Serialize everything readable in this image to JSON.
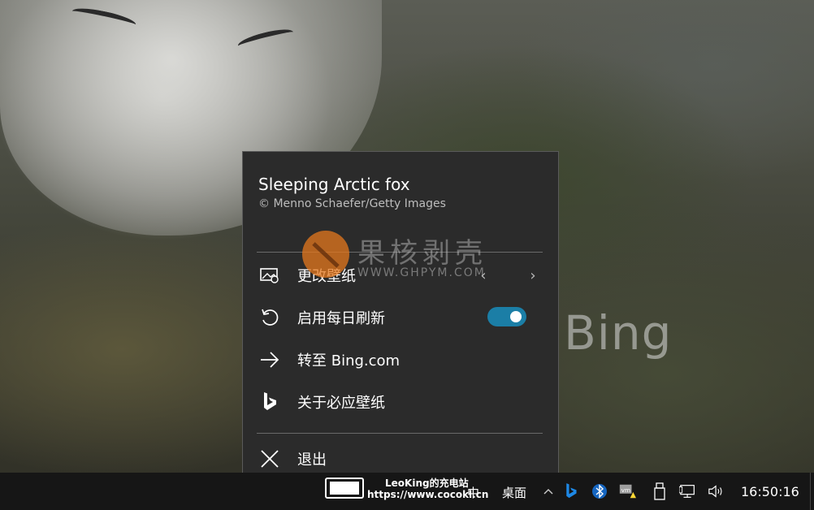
{
  "wallpaper": {
    "watermark_text": "Bing"
  },
  "site_watermark": {
    "chinese": "果核剥壳",
    "url": "WWW.GHPYM.COM"
  },
  "menu": {
    "title": "Sleeping Arctic fox",
    "credit": "©  Menno Schaefer/Getty Images",
    "items": [
      {
        "label": "更改壁纸",
        "icon": "change-wallpaper-icon"
      },
      {
        "label": "启用每日刷新",
        "icon": "refresh-icon",
        "toggle_on": true
      },
      {
        "label": "转至 Bing.com",
        "icon": "arrow-right-icon"
      },
      {
        "label": "关于必应壁纸",
        "icon": "bing-logo-icon"
      },
      {
        "label": "退出",
        "icon": "close-icon"
      }
    ],
    "chevron_prev": "‹",
    "chevron_next": "›"
  },
  "overlay_badge": {
    "line1": "LeoKing的充电站",
    "line2": "https://www.cocokl.cn"
  },
  "taskbar": {
    "ime_label": "中",
    "desktop_label": "桌面",
    "clock": "16:50:16",
    "colors": {
      "accent": "#1b7ea6",
      "bing_blue": "#1e88e5"
    }
  }
}
